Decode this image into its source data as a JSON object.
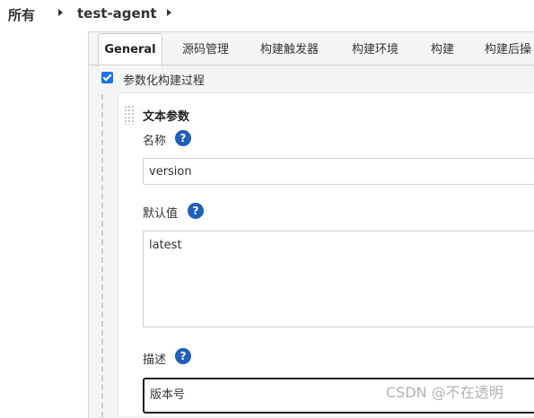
{
  "breadcrumb": {
    "root": "所有",
    "job": "test-agent"
  },
  "tabs": [
    "General",
    "源码管理",
    "构建触发器",
    "构建环境",
    "构建",
    "构建后操"
  ],
  "active_tab": "General",
  "parameterized": {
    "label": "参数化构建过程",
    "checked": true
  },
  "parameter": {
    "type_title": "文本参数",
    "name_label": "名称",
    "name_value": "version",
    "default_label": "默认值",
    "default_value": "latest",
    "description_label": "描述",
    "description_value": "版本号"
  },
  "help_glyph": "?",
  "watermark": "CSDN @不在透明",
  "colors": {
    "checkbox": "#1a73e8",
    "help_icon": "#1f5fb8",
    "focus_border": "#222222"
  }
}
